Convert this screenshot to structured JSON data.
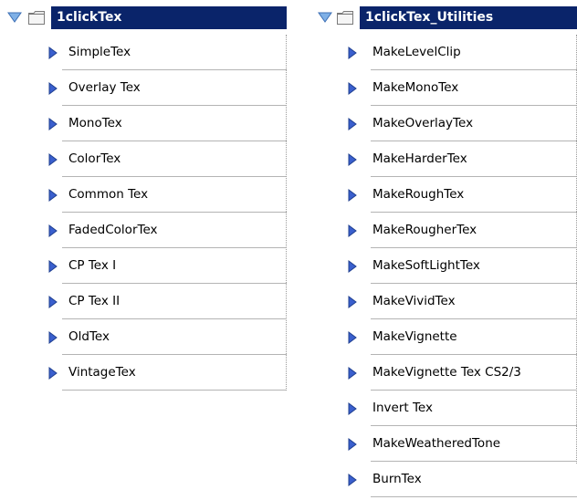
{
  "sets": [
    {
      "title": "1clickTex",
      "actions": [
        "SimpleTex",
        "Overlay Tex",
        "MonoTex",
        "ColorTex",
        "Common Tex",
        "FadedColorTex",
        "CP Tex I",
        "CP Tex II",
        "OldTex",
        "VintageTex"
      ]
    },
    {
      "title": "1clickTex_Utilities",
      "actions": [
        "MakeLevelClip",
        "MakeMonoTex",
        "MakeOverlayTex",
        "MakeHarderTex",
        "MakeRoughTex",
        "MakeRougherTex",
        "MakeSoftLightTex",
        "MakeVividTex",
        "MakeVignette",
        "MakeVignette Tex CS2/3",
        "Invert Tex",
        "MakeWeatheredTone",
        "BurnTex"
      ]
    }
  ],
  "icons": {
    "expand": "triangle-down-icon",
    "set": "folder-icon",
    "action": "play-triangle-icon"
  },
  "colors": {
    "selection": "#0a246a",
    "selection_text": "#ffffff",
    "row_divider": "#b4b4b4",
    "play_fill": "#3a5fcd"
  }
}
